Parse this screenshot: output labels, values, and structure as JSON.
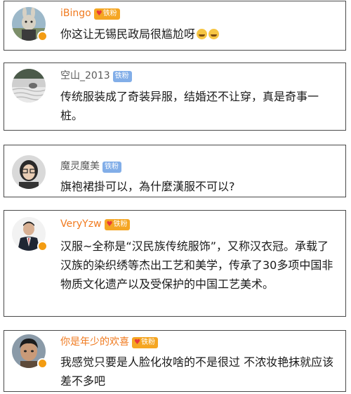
{
  "comments": [
    {
      "username": "iBingo",
      "name_color": "#f07a1f",
      "fan_badge": "铁粉",
      "verified": true,
      "text": "你这让无锡民政局很尴尬呀",
      "emojis": [
        "laugh-cry-emoji",
        "laugh-cry-emoji"
      ]
    },
    {
      "username": "空山_2013",
      "name_color": "#5a5a5a",
      "fan_badge": "铁粉",
      "verified": false,
      "text": "传统服装成了奇装异服，结婚还不让穿，真是奇事一桩。"
    },
    {
      "username": "魔灵魔美",
      "name_color": "#5a5a5a",
      "fan_badge": "铁粉",
      "verified": false,
      "text": "旗袍裙掛可以，為什麼漢服不可以?"
    },
    {
      "username": "VeryYzw",
      "name_color": "#f07a1f",
      "fan_badge": "铁粉",
      "verified": true,
      "text": "汉服~全称是“汉民族传统服饰”，又称汉衣冠。承载了汉族的染织绣等杰出工艺和美学，传承了30多项中国非物质文化遗产以及受保护的中国工艺美术。"
    },
    {
      "username": "你是年少的欢喜",
      "name_color": "#f07a1f",
      "fan_badge": "铁粉",
      "verified": true,
      "text": "我感觉只要是人脸化妆啥的不是很过 不浓妆艳抹就应该差不多吧"
    }
  ]
}
